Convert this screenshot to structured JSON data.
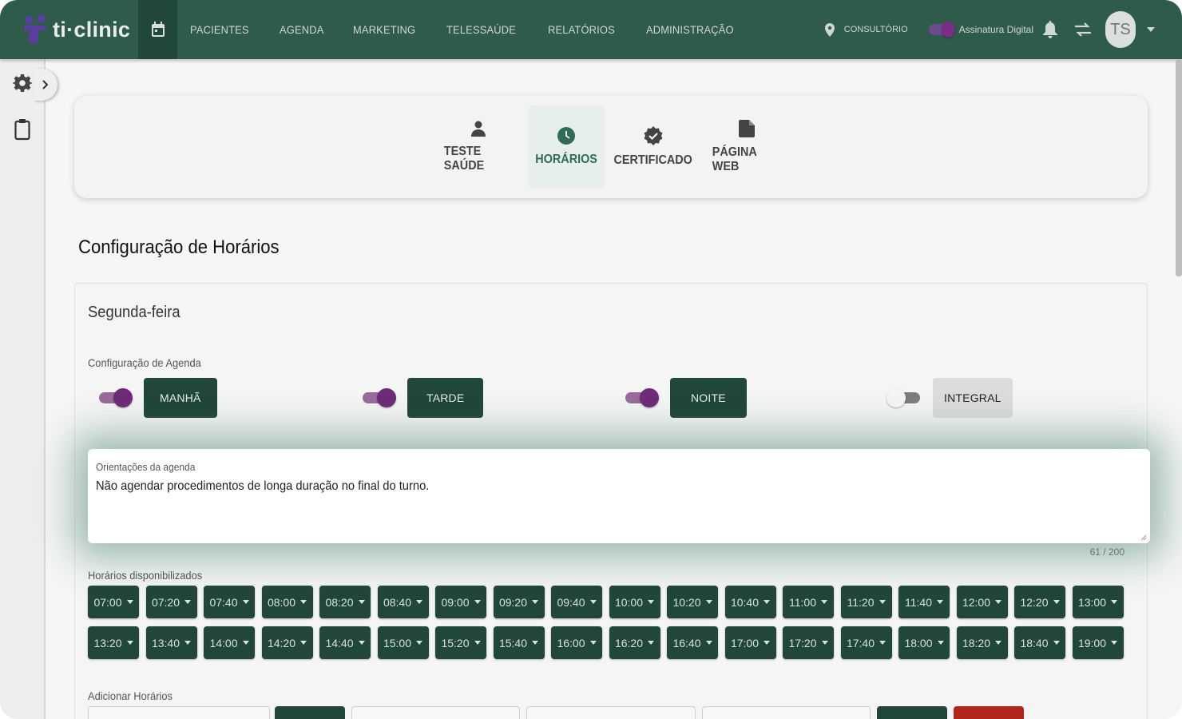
{
  "brand": {
    "name": "ti·clinic"
  },
  "nav": {
    "items": [
      "PACIENTES",
      "AGENDA",
      "MARKETING",
      "TELESSAÚDE",
      "RELATÓRIOS",
      "ADMINISTRAÇÃO"
    ]
  },
  "header": {
    "location": "CONSULTÓRIO",
    "signature_label": "Assinatura Digital",
    "avatar_initials": "TS"
  },
  "tabs": [
    {
      "label": "TESTE SAÚDE",
      "icon": "person-icon"
    },
    {
      "label": "HORÁRIOS",
      "icon": "clock-icon",
      "active": true
    },
    {
      "label": "CERTIFICADO",
      "icon": "verified-icon"
    },
    {
      "label": "PÁGINA WEB",
      "icon": "web-page-icon"
    }
  ],
  "page": {
    "title": "Configuração de Horários",
    "day": "Segunda-feira",
    "schedule_config_label": "Configuração de Agenda",
    "shifts": [
      {
        "label": "MANHÃ",
        "enabled": true
      },
      {
        "label": "TARDE",
        "enabled": true
      },
      {
        "label": "NOITE",
        "enabled": true
      },
      {
        "label": "INTEGRAL",
        "enabled": false
      }
    ],
    "notes": {
      "label": "Orientações da agenda",
      "value": "Não agendar procedimentos de longa duração no final do turno.",
      "counter": "61 / 200"
    },
    "available_label": "Horários disponibilizados",
    "times_row1": [
      "07:00",
      "07:20",
      "07:40",
      "08:00",
      "08:20",
      "08:40",
      "09:00",
      "09:20",
      "09:40",
      "10:00",
      "10:20",
      "10:40",
      "11:00",
      "11:20",
      "11:40",
      "12:00",
      "12:20",
      "13:00"
    ],
    "times_row2": [
      "13:20",
      "13:40",
      "14:00",
      "14:20",
      "14:40",
      "15:00",
      "15:20",
      "15:40",
      "16:00",
      "16:20",
      "16:40",
      "17:00",
      "17:20",
      "17:40",
      "18:00",
      "18:20",
      "18:40",
      "19:00"
    ],
    "add_label": "Adicionar Horários"
  },
  "colors": {
    "topbar": "#2f5b4a",
    "dark_green": "#21463a",
    "toggle_purple": "#6e2b78",
    "danger": "#b3261e"
  }
}
